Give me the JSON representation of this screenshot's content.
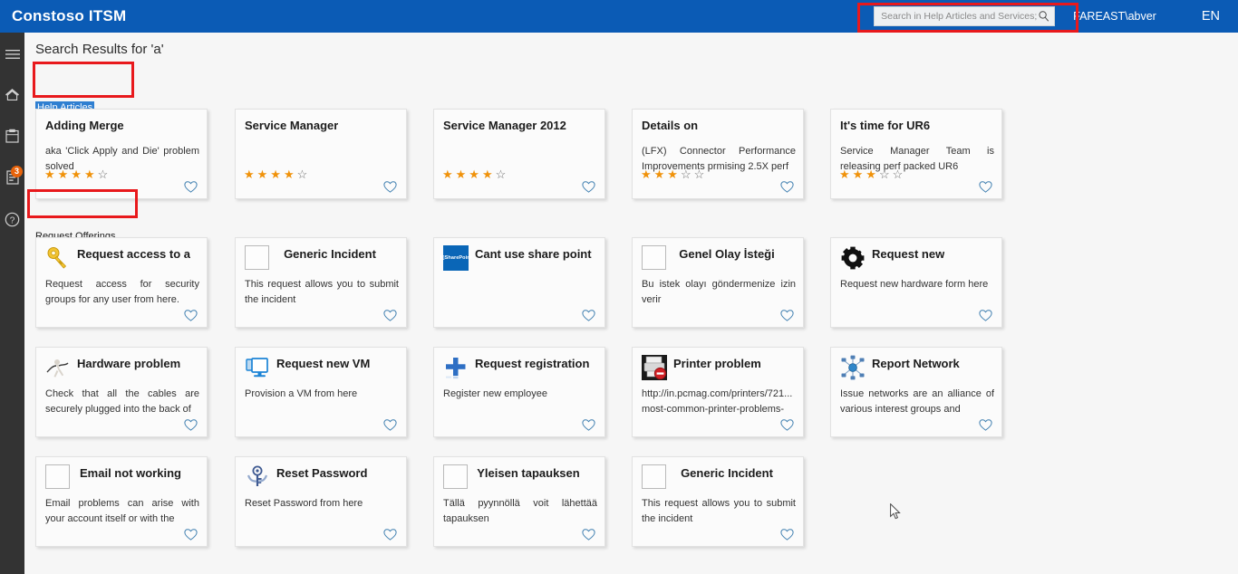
{
  "header": {
    "brand": "Constoso ITSM",
    "search": {
      "placeholder": "Search in Help Articles and Services;",
      "value": "",
      "icon": "search-icon"
    },
    "user": "FAREAST\\abver",
    "language": "EN",
    "accent_color": "#0b5bb5"
  },
  "sidebar": {
    "background": "#333333",
    "items": [
      {
        "name": "menu-hamburger",
        "icon": "hamburger-icon",
        "badge": ""
      },
      {
        "name": "home",
        "icon": "home-icon",
        "badge": ""
      },
      {
        "name": "my-requests",
        "icon": "clipboard-icon",
        "badge": ""
      },
      {
        "name": "my-activities",
        "icon": "document-list-icon",
        "badge": "3"
      },
      {
        "name": "help",
        "icon": "question-circle-icon",
        "badge": ""
      }
    ]
  },
  "main": {
    "page_title": "Search Results for 'a'",
    "groups": [
      {
        "label": "Help Articles",
        "selected": true
      },
      {
        "label": "Request Offerings",
        "selected": false
      }
    ],
    "annotation_color": "#e8191c"
  },
  "rows": [
    {
      "group": "Help Articles",
      "cards": [
        {
          "title": "Adding Merge",
          "desc": "aka 'Click Apply and Die' problem solved",
          "icon": "none",
          "rating_filled": 4,
          "rating_total": 5,
          "favorite": false
        },
        {
          "title": "Service Manager",
          "desc": "",
          "icon": "none",
          "rating_filled": 4,
          "rating_total": 5,
          "favorite": false
        },
        {
          "title": "Service Manager 2012",
          "desc": "",
          "icon": "none",
          "rating_filled": 4,
          "rating_total": 5,
          "favorite": false
        },
        {
          "title": "Details on",
          "desc": "(LFX) Connector Performance Improvements prmising 2.5X perf",
          "icon": "none",
          "rating_filled": 3,
          "rating_total": 5,
          "favorite": false
        },
        {
          "title": "It's time for UR6",
          "desc": "Service Manager Team is releasing perf packed UR6",
          "icon": "none",
          "rating_filled": 3,
          "rating_total": 5,
          "favorite": false
        }
      ]
    },
    {
      "group": "Request Offerings",
      "cards": [
        {
          "title": "Request access to a",
          "desc": "Request access for security groups for any user from here.",
          "icon": "key-icon",
          "rating_filled": 0,
          "rating_total": 0,
          "favorite": false
        },
        {
          "title": "Generic Incident",
          "desc": "This request allows you to submit the incident",
          "icon": "blank-icon",
          "rating_filled": 0,
          "rating_total": 0,
          "favorite": false
        },
        {
          "title": "Cant use share point",
          "desc": "",
          "icon": "sharepoint-icon",
          "rating_filled": 0,
          "rating_total": 0,
          "favorite": false
        },
        {
          "title": "Genel Olay İsteği",
          "desc": "Bu istek olayı göndermenize izin verir",
          "icon": "blank-icon",
          "rating_filled": 0,
          "rating_total": 0,
          "favorite": false
        },
        {
          "title": "Request new",
          "desc": "Request new hardware form here",
          "icon": "gear-icon",
          "rating_filled": 0,
          "rating_total": 0,
          "favorite": false
        }
      ]
    },
    {
      "group": "",
      "cards": [
        {
          "title": "Hardware problem",
          "desc": "Check that all the cables are securely plugged into the back of",
          "icon": "person-cable-icon",
          "rating_filled": 0,
          "rating_total": 0,
          "favorite": false
        },
        {
          "title": "Request new VM",
          "desc": "Provision a VM from here",
          "icon": "monitor-icon",
          "rating_filled": 0,
          "rating_total": 0,
          "favorite": false
        },
        {
          "title": "Request registration",
          "desc": "Register new employee",
          "icon": "plus-icon",
          "rating_filled": 0,
          "rating_total": 0,
          "favorite": false
        },
        {
          "title": "Printer problem",
          "desc": "http://in.pcmag.com/printers/721... most-common-printer-problems-",
          "icon": "printer-error-icon",
          "rating_filled": 0,
          "rating_total": 0,
          "favorite": false
        },
        {
          "title": "Report Network",
          "desc": "Issue networks are an alliance of various interest groups and",
          "icon": "network-icon",
          "rating_filled": 0,
          "rating_total": 0,
          "favorite": false
        }
      ]
    },
    {
      "group": "",
      "cards": [
        {
          "title": "Email not working",
          "desc": "Email problems can arise with your account itself or with the",
          "icon": "blank-icon",
          "rating_filled": 0,
          "rating_total": 0,
          "favorite": false
        },
        {
          "title": "Reset Password",
          "desc": "Reset Password from here",
          "icon": "key-reset-icon",
          "rating_filled": 0,
          "rating_total": 0,
          "favorite": false
        },
        {
          "title": "Yleisen tapauksen",
          "desc": "Tällä pyynnöllä voit lähettää tapauksen",
          "icon": "blank-icon",
          "rating_filled": 0,
          "rating_total": 0,
          "favorite": false
        },
        {
          "title": "Generic Incident",
          "desc": "This request allows you to submit the incident",
          "icon": "blank-icon",
          "rating_filled": 0,
          "rating_total": 0,
          "favorite": false
        }
      ]
    }
  ]
}
